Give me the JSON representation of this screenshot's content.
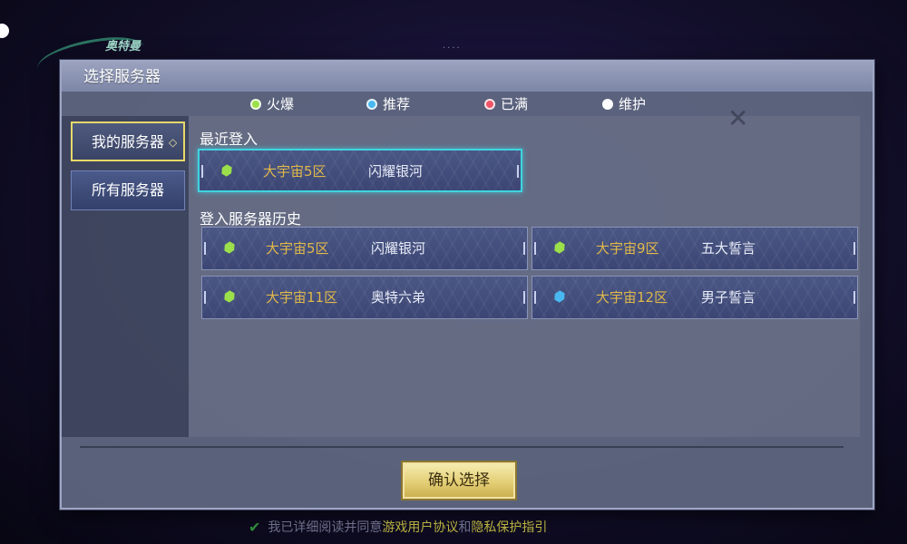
{
  "background": {
    "logo_text": "奥特曼"
  },
  "dialog": {
    "title": "选择服务器",
    "legend": [
      {
        "label": "火爆",
        "color": "#9be04a"
      },
      {
        "label": "推荐",
        "color": "#4ab8f0"
      },
      {
        "label": "已满",
        "color": "#f05468"
      },
      {
        "label": "维护",
        "color": "#ffffff"
      }
    ],
    "nav": {
      "mine": "我的服务器",
      "all": "所有服务器"
    },
    "recent": {
      "label": "最近登入",
      "server": {
        "zone": "大宇宙5区",
        "name": "闪耀银河",
        "status_color": "#9be04a"
      }
    },
    "history": {
      "label": "登入服务器历史",
      "servers": [
        {
          "zone": "大宇宙5区",
          "name": "闪耀银河",
          "status_color": "#9be04a"
        },
        {
          "zone": "大宇宙9区",
          "name": "五大誓言",
          "status_color": "#9be04a"
        },
        {
          "zone": "大宇宙11区",
          "name": "奥特六弟",
          "status_color": "#9be04a"
        },
        {
          "zone": "大宇宙12区",
          "name": "男子誓言",
          "status_color": "#4ab8f0"
        }
      ]
    },
    "confirm_label": "确认选择"
  },
  "footer": {
    "agree_prefix": "我已详细阅读并同意",
    "user_agreement": "游戏用户协议",
    "and": "和",
    "privacy": "隐私保护指引"
  }
}
